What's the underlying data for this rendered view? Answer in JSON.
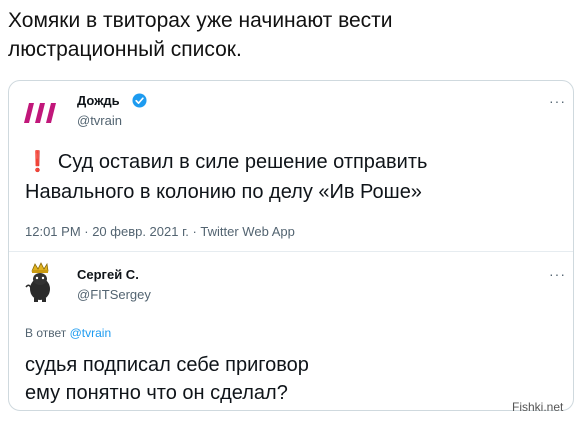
{
  "post": {
    "text_line1": "Хомяки в твиторах уже начинают вести",
    "text_line2": "люстрационный список."
  },
  "tweet": {
    "author_name": "Дождь",
    "handle": "@tvrain",
    "more": "···",
    "exclaim": "❗",
    "text_line1": "Суд оставил в силе решение отправить",
    "text_line2": "Навального в колонию по делу «Ив Роше»",
    "meta": "12:01 PM · 20 февр. 2021 г. · Twitter Web App",
    "colors": {
      "logo": "#c1177a",
      "verified": "#1d9bf0"
    }
  },
  "reply": {
    "author_name": "Сергей С.",
    "handle": "@FITSergey",
    "more": "···",
    "reply_to_prefix": "В ответ",
    "reply_to_handle": "@tvrain",
    "text_line1": "судья подписал себе приговор",
    "text_line2": "ему понятно что он сделал?"
  },
  "watermark": "Fishki.net",
  "icons": [
    "tvrain-logo-icon",
    "verified-badge-icon",
    "hamster-king-avatar-icon",
    "more-icon"
  ]
}
